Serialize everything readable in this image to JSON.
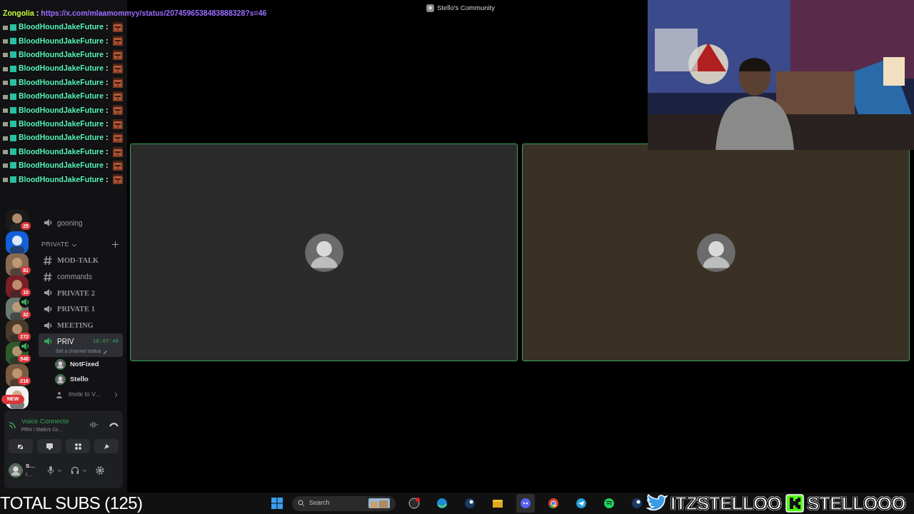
{
  "chat_overlay": {
    "messages": [
      {
        "kind": "link",
        "author": "Zongolia",
        "colon": ":",
        "text": "https://x.com/mlaamommyy/status/2074596538483888328?s=46"
      },
      {
        "kind": "emote",
        "author": "BloodHoundJakeFuture",
        "colon": ":"
      },
      {
        "kind": "emote",
        "author": "BloodHoundJakeFuture",
        "colon": ":"
      },
      {
        "kind": "emote",
        "author": "BloodHoundJakeFuture",
        "colon": ":"
      },
      {
        "kind": "emote",
        "author": "BloodHoundJakeFuture",
        "colon": ":"
      },
      {
        "kind": "emote",
        "author": "BloodHoundJakeFuture",
        "colon": ":"
      },
      {
        "kind": "emote",
        "author": "BloodHoundJakeFuture",
        "colon": ":"
      },
      {
        "kind": "emote",
        "author": "BloodHoundJakeFuture",
        "colon": ":"
      },
      {
        "kind": "emote",
        "author": "BloodHoundJakeFuture",
        "colon": ":"
      },
      {
        "kind": "emote",
        "author": "BloodHoundJakeFuture",
        "colon": ":"
      },
      {
        "kind": "emote",
        "author": "BloodHoundJakeFuture",
        "colon": ":"
      },
      {
        "kind": "emote",
        "author": "BloodHoundJakeFuture",
        "colon": ":"
      },
      {
        "kind": "emote",
        "author": "BloodHoundJakeFuture",
        "colon": ":"
      }
    ]
  },
  "servers": [
    {
      "badge": "25",
      "voice": false
    },
    {
      "voice": false
    },
    {
      "badge": "81",
      "voice": false
    },
    {
      "badge": "10",
      "voice": false
    },
    {
      "badge": "32",
      "voice": true
    },
    {
      "badge": "272",
      "voice": false
    },
    {
      "badge": "548",
      "voice": true
    },
    {
      "badge": "216",
      "voice": false
    },
    {
      "badge": "NEW",
      "voice": false
    }
  ],
  "channels": [
    {
      "kind": "voice",
      "name": "gooning",
      "fancy": false,
      "selected": false
    },
    {
      "kind": "category",
      "name": "PRIVATE"
    },
    {
      "kind": "text",
      "name": "MOD-TALK",
      "fancy": true,
      "selected": false
    },
    {
      "kind": "text",
      "name": "commands",
      "fancy": false,
      "selected": false
    },
    {
      "kind": "voice",
      "name": "PRIVATE 2",
      "fancy": true,
      "selected": false
    },
    {
      "kind": "voice",
      "name": "PRIVATE 1",
      "fancy": true,
      "selected": false
    },
    {
      "kind": "voice",
      "name": "MEETING",
      "fancy": true,
      "selected": false
    },
    {
      "kind": "voice",
      "name": "PRIV",
      "fancy": false,
      "selected": true,
      "timer": "16:07:49",
      "status": "Set a channel status"
    },
    {
      "kind": "member",
      "name": "NotFixed"
    },
    {
      "kind": "member",
      "name": "Stello"
    },
    {
      "kind": "invite",
      "name": "Invite to V…"
    }
  ],
  "voice_panel": {
    "status": "Voice Connecte",
    "location": "PRIV / Stello's Co…"
  },
  "user_panel": {
    "name": "S…",
    "status": "I…"
  },
  "main": {
    "title": "Stello's Community",
    "tiles": [
      {
        "speaking": true,
        "color": "#2b2b2b"
      },
      {
        "speaking": true,
        "color": "#3a3125"
      }
    ]
  },
  "subs_counter": "TOTAL SUBS (125)",
  "taskbar": {
    "search_placeholder": "Search",
    "apps": [
      {
        "kind": "obs",
        "selected": false
      },
      {
        "kind": "edge",
        "selected": false
      },
      {
        "kind": "steam",
        "selected": false
      },
      {
        "kind": "folder",
        "selected": false
      },
      {
        "kind": "discord",
        "selected": true
      },
      {
        "kind": "chrome",
        "selected": false
      },
      {
        "kind": "telegram",
        "selected": false
      },
      {
        "kind": "spotify",
        "selected": false
      },
      {
        "kind": "steam",
        "selected": false
      }
    ]
  },
  "socials": [
    {
      "kind": "twitter",
      "handle": "ITZSTELLOO"
    },
    {
      "kind": "kick",
      "handle": "STELLOOO"
    }
  ]
}
